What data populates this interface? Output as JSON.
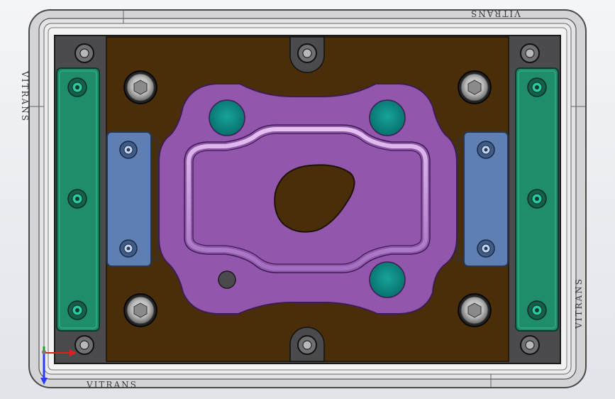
{
  "engraving": {
    "top": "VITRANS",
    "bottom": "VITRANS",
    "left": "VITRANS",
    "right": "VITRANS"
  },
  "colors": {
    "frame": "#dcdcdc",
    "base_plate": "#4b4b4d",
    "die_block": "#4a2e0a",
    "locating_rail": "#1f8c6c",
    "clamp_plate": "#5f7fb2",
    "part": "#9356ad",
    "pilot_pin": "#0b8580"
  },
  "icons": {
    "triad": "axis-triad-icon",
    "bolt": "socket-head-bolt-icon",
    "hole": "bolt-hole-icon"
  }
}
